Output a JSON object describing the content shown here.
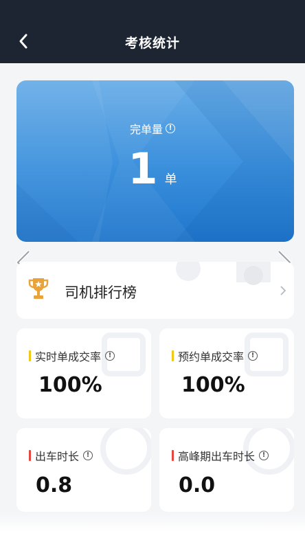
{
  "header": {
    "title": "考核统计",
    "back_icon": "chevron-left-icon"
  },
  "summary": {
    "label": "完单量",
    "value": "1",
    "unit": "单",
    "info_icon": "info-icon"
  },
  "ranking": {
    "label": "司机排行榜",
    "icon": "trophy-icon",
    "arrow_icon": "chevron-right-icon"
  },
  "metrics": [
    {
      "title": "实时单成交率",
      "value": "100%",
      "accent": "#f5c518"
    },
    {
      "title": "预约单成交率",
      "value": "100%",
      "accent": "#f5c518"
    },
    {
      "title": "出车时长",
      "value": "0.8",
      "accent": "#e8453c"
    },
    {
      "title": "高峰期出车时长",
      "value": "0.0",
      "accent": "#e8453c"
    }
  ],
  "colors": {
    "header_bg": "#1e2532",
    "card_blue": "#3a8fdc",
    "background": "#f4f5f7"
  }
}
